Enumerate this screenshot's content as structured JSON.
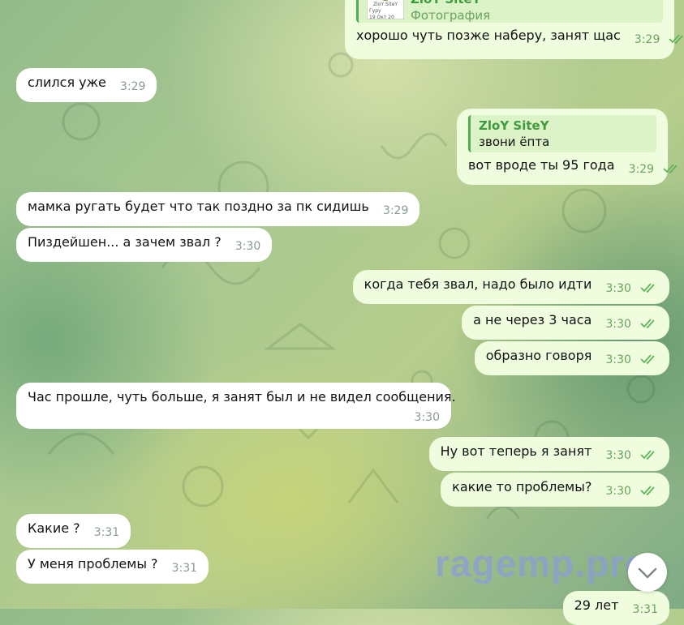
{
  "messages": [
    {
      "dir": "out",
      "reply": {
        "name": "ZloY SiteY",
        "text": "Фотография",
        "thumb_lines": [
          "ZloY SiteY",
          "Гуру",
          "19 Окт 20"
        ]
      },
      "text": "хорошо чуть позже наберу, занят щас",
      "time": "3:29"
    },
    {
      "dir": "in",
      "text": "слился уже",
      "time": "3:29"
    },
    {
      "dir": "out",
      "reply": {
        "name": "ZloY SiteY",
        "text": "звони ёпта"
      },
      "text": "вот вроде ты 95 года",
      "time": "3:29"
    },
    {
      "dir": "in",
      "text": "мамка ругать будет что так поздно за пк сидишь",
      "time": "3:29"
    },
    {
      "dir": "in",
      "text": "Пиздейшен... а зачем звал ?",
      "time": "3:30"
    },
    {
      "dir": "out",
      "text": "когда тебя звал, надо было идти",
      "time": "3:30"
    },
    {
      "dir": "out",
      "text": "а не через 3 часа",
      "time": "3:30"
    },
    {
      "dir": "out",
      "text": "образно говоря",
      "time": "3:30"
    },
    {
      "dir": "in",
      "text": "Час прошле, чуть больше, я занят был и не видел сообщения.",
      "time": "3:30"
    },
    {
      "dir": "out",
      "text": "Ну вот теперь я занят",
      "time": "3:30"
    },
    {
      "dir": "out",
      "text": "какие то проблемы?",
      "time": "3:30"
    },
    {
      "dir": "in",
      "text": "Какие ?",
      "time": "3:31"
    },
    {
      "dir": "in",
      "text": "У меня проблемы ?",
      "time": "3:31"
    },
    {
      "dir": "out",
      "text": "29 лет",
      "time": "3:31"
    }
  ],
  "watermark": "ragemp.pro",
  "icons": {
    "read": "double-check-icon",
    "scroll": "chevron-down-icon"
  },
  "colors": {
    "incoming": "#ffffff",
    "outgoing": "#effdde",
    "accent": "#4fae4e",
    "time_out": "#6aa35e",
    "time_in": "#8a9a96"
  }
}
